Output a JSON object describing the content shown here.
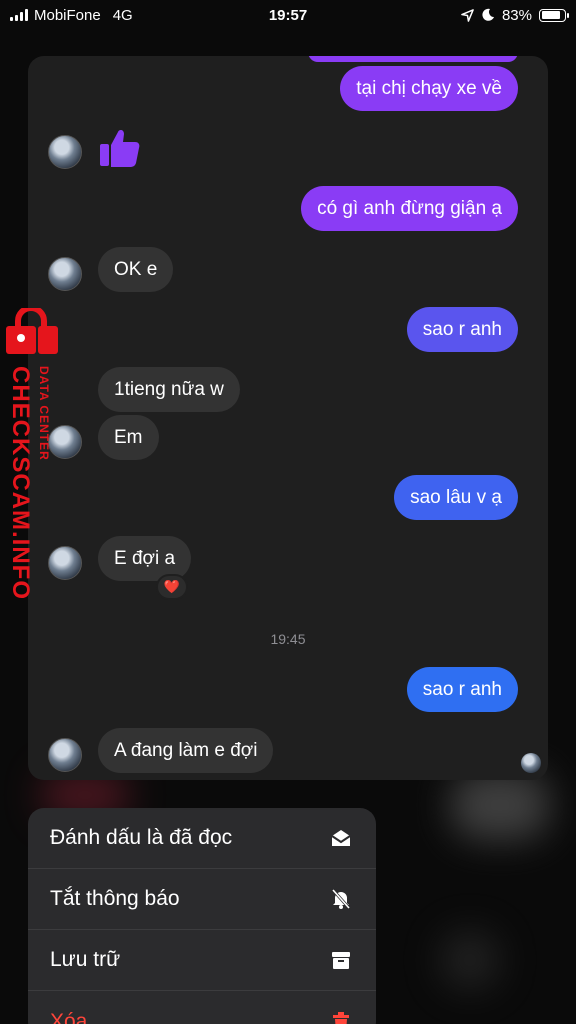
{
  "status_bar": {
    "carrier": "MobiFone",
    "network": "4G",
    "time": "19:57",
    "battery": "83%",
    "battery_level": 0.83
  },
  "messages": {
    "m1": "tại chị chạy xe về",
    "m2": "có gì anh đừng giận ạ",
    "m3": "OK e",
    "m4": "sao r anh",
    "m5": "1tieng nữa w",
    "m6": "Em",
    "m7": "sao lâu v ạ",
    "m8": "E đợi a",
    "m8_reaction": "❤️",
    "timestamp": "19:45",
    "m9": "sao r anh",
    "m10": "A đang làm e đợi"
  },
  "watermark": {
    "main": "CHECKSCAM.INFO",
    "sub": "DATA CENTER"
  },
  "menu": {
    "mark_read": "Đánh dấu là đã đọc",
    "mute": "Tắt thông báo",
    "archive": "Lưu trữ",
    "delete": "Xóa"
  },
  "colors": {
    "outgoing_purple": "#8a3cf5",
    "outgoing_blue": "#2f6ff2",
    "incoming": "#333333",
    "danger": "#ff453a",
    "watermark": "#e5151c"
  }
}
